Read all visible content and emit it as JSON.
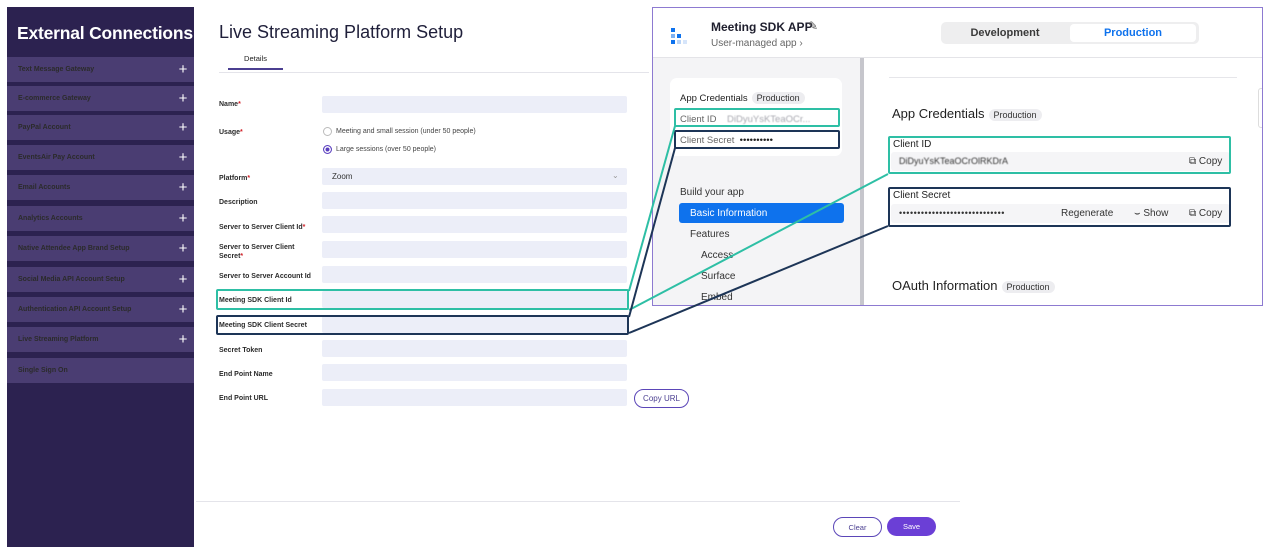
{
  "sidebar": {
    "title": "External Connections",
    "items": [
      {
        "label": "Text Message Gateway",
        "plus": "+"
      },
      {
        "label": "E-commerce Gateway",
        "plus": "+"
      },
      {
        "label": "PayPal Account",
        "plus": "+"
      },
      {
        "label": "EventsAir Pay Account",
        "plus": "+"
      },
      {
        "label": "Email Accounts",
        "plus": "+"
      },
      {
        "label": "Analytics Accounts",
        "plus": "+"
      },
      {
        "label": "Native Attendee App Brand Setup",
        "plus": "+"
      },
      {
        "label": "Social Media API Account Setup",
        "plus": "+"
      },
      {
        "label": "Authentication API Account Setup",
        "plus": "+"
      },
      {
        "label": "Live Streaming Platform",
        "plus": "+"
      },
      {
        "label": "Single Sign On",
        "plus": ""
      }
    ]
  },
  "form": {
    "title": "Live Streaming Platform Setup",
    "tab": "Details",
    "labels": {
      "name": "Name",
      "usage": "Usage",
      "platform": "Platform",
      "description": "Description",
      "s2s_client_id": "Server to Server Client Id",
      "s2s_client_secret_1": "Server to Server Client",
      "s2s_client_secret_2": "Secret",
      "s2s_account_id": "Server to Server Account Id",
      "sdk_client_id": "Meeting SDK Client Id",
      "sdk_client_secret": "Meeting SDK Client Secret",
      "secret_token": "Secret Token",
      "end_point_name": "End Point Name",
      "end_point_url": "End Point URL"
    },
    "required_mark": "*",
    "usage_options": [
      {
        "label": "Meeting and small session (under 50 people)",
        "selected": false
      },
      {
        "label": "Large sessions (over 50 people)",
        "selected": true
      }
    ],
    "platform_value": "Zoom",
    "copy_url": "Copy URL",
    "clear": "Clear",
    "save": "Save"
  },
  "zoom": {
    "app_name": "Meeting SDK APP",
    "app_sub": "User-managed app ›",
    "seg_dev": "Development",
    "seg_prod": "Production",
    "card_title": "App Credentials",
    "card_badge": "Production",
    "card_client_id_label": "Client ID",
    "card_client_id_value": "DiDyuYsKTeaOCr...",
    "card_client_secret_label": "Client Secret",
    "card_client_secret_value": "••••••••••",
    "nav_heading": "Build your app",
    "nav_items": [
      "Basic Information",
      "Features",
      "Access",
      "Surface",
      "Embed"
    ],
    "main_title": "App Credentials",
    "main_badge": "Production",
    "client_id_label": "Client ID",
    "client_id_value": "DiDyuYsKTeaOCrOlRKDrA",
    "client_secret_label": "Client Secret",
    "client_secret_value": "•••••••••••••••••••••••••••••",
    "copy": "Copy",
    "regenerate": "Regenerate",
    "show": "Show",
    "oauth_title": "OAuth Information",
    "oauth_badge": "Production"
  },
  "colors": {
    "sidebar_bg": "#2c2250",
    "sidebar_item": "#4a3d72",
    "accent_purple": "#6b3fd6",
    "zoom_blue": "#0e72ed",
    "highlight_teal": "#2ebfa5",
    "highlight_navy": "#1d3557"
  }
}
